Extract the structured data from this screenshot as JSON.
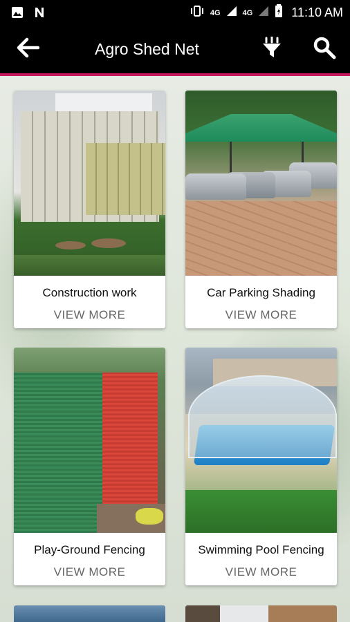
{
  "status_bar": {
    "left_icons": [
      "image-icon",
      "n-icon"
    ],
    "right_icons": [
      "vibrate-icon",
      "signal-4g-icon",
      "signal-4g-icon",
      "battery-icon"
    ],
    "network1": "4G",
    "network2": "4G",
    "time": "11:10 AM"
  },
  "app_bar": {
    "title": "Agro Shed Net",
    "back_icon": "arrow-back-icon",
    "filter_icon": "filter-icon",
    "search_icon": "search-icon",
    "accent_line_color": "#c2185b"
  },
  "cards": [
    {
      "label": "Construction work",
      "more": "VIEW MORE"
    },
    {
      "label": "Car Parking Shading",
      "more": "VIEW MORE"
    },
    {
      "label": "Play-Ground Fencing",
      "more": "VIEW MORE"
    },
    {
      "label": "Swimming Pool Fencing",
      "more": "VIEW MORE"
    }
  ]
}
